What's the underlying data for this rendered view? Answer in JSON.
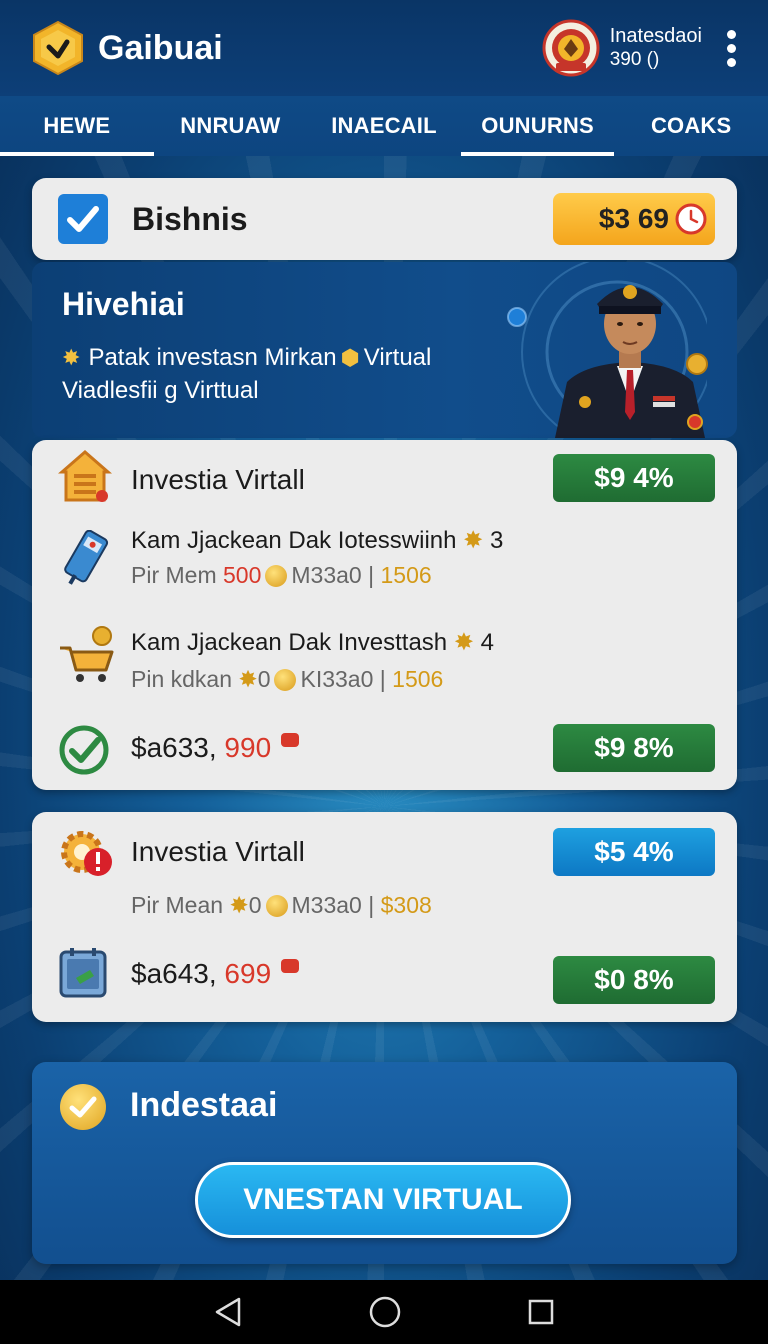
{
  "header": {
    "app_name": "Gaibuai",
    "user_name": "Inatesdaoi",
    "user_value": "390 ()"
  },
  "tabs": [
    {
      "label": "HEWE",
      "active": true
    },
    {
      "label": "NNRUAW",
      "active": false
    },
    {
      "label": "INAECAIL",
      "active": false
    },
    {
      "label": "OUNURNS",
      "active": true
    },
    {
      "label": "COAKS",
      "active": false
    }
  ],
  "business": {
    "title": "Bishnis",
    "balance": "$3 69"
  },
  "hero": {
    "title": "Hivehiai",
    "line1_a": "Patak investasn Mirkan",
    "line1_b": "Virtual",
    "line2": "Viadlesfii g Virttual"
  },
  "investment_card_1": {
    "title": "Investia Virtall",
    "pill": "$9 4%",
    "item1": {
      "title": "Kam Jjackean Dak Iotesswiinh",
      "badge": "3",
      "meta_a": "Pir Mem",
      "meta_red": "500",
      "meta_b": "M33a0",
      "meta_sep": "|",
      "meta_gold": "1506"
    },
    "item2": {
      "title": "Kam Jjackean Dak Investtash",
      "badge": "4",
      "meta_a": "Pin kdkan",
      "meta_b": "0",
      "meta_c": "KI33a0",
      "meta_sep": "|",
      "meta_gold": "1506"
    },
    "total_a": "$a633,",
    "total_red": "990",
    "total_pill": "$9 8%"
  },
  "investment_card_2": {
    "title": "Investia Virtall",
    "pill": "$5 4%",
    "meta_a": "Pir Mean",
    "meta_b": "0",
    "meta_c": "M33a0",
    "meta_sep": "|",
    "meta_gold": "$308",
    "total_a": "$a643,",
    "total_red": "699",
    "total_pill": "$0 8%"
  },
  "bottom": {
    "title": "Indestaai",
    "cta": "VNESTAN VIRTUAL"
  },
  "colors": {
    "header_bg": "#0a3566",
    "accent_green": "#2d8a42",
    "accent_blue": "#1ea0e0",
    "accent_gold": "#f4a51c",
    "accent_red": "#d8382a"
  }
}
